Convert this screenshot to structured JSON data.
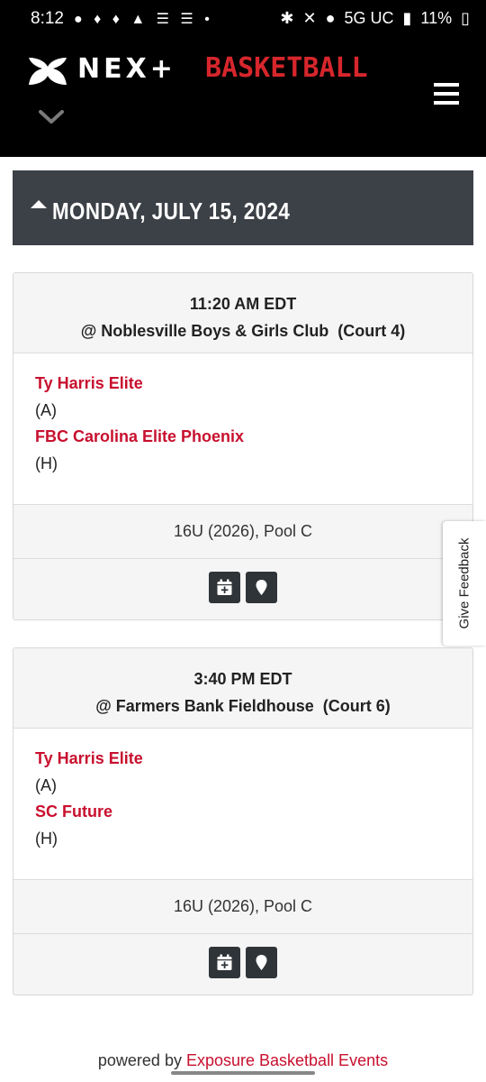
{
  "status": {
    "time": "8:12",
    "network": "5G UC",
    "battery": "11%"
  },
  "brand": {
    "next_word": "NEX+",
    "basketball_word": "BASKETBALL",
    "accent": "#d6262c"
  },
  "schedule": {
    "date": "MONDAY, JULY 15, 2024",
    "games": [
      {
        "time": "11:20 AM EDT",
        "location": "@ Noblesville Boys & Girls Club  (Court 4)",
        "away_team": "Ty Harris Elite",
        "away_side": "(A)",
        "home_team": "FBC Carolina Elite Phoenix",
        "home_side": "(H)",
        "division": "16U (2026), Pool C"
      },
      {
        "time": "3:40 PM EDT",
        "location": "@ Farmers Bank Fieldhouse  (Court 6)",
        "away_team": "Ty Harris Elite",
        "away_side": "(A)",
        "home_team": "SC Future",
        "home_side": "(H)",
        "division": "16U (2026), Pool C"
      }
    ]
  },
  "feedback": {
    "label": "Give Feedback"
  },
  "footer": {
    "powered_by": "powered by",
    "link_text": "Exposure Basketball Events"
  },
  "icons": {
    "calendar": "calendar-add-icon",
    "map": "map-marker-icon",
    "menu": "hamburger-menu-icon"
  }
}
